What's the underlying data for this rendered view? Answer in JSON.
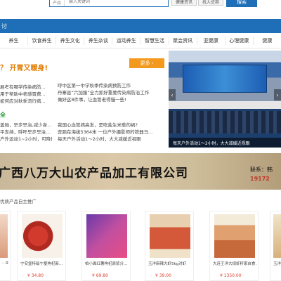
{
  "search": {
    "category": "产品",
    "placeholder": "输入关键词",
    "button": "搜索",
    "btn_a": "健康资讯",
    "btn_b": "找入驻商"
  },
  "band": {
    "label": "讨"
  },
  "nav": [
    "养生",
    "饮食养生",
    "养生文化",
    "养生杂谈",
    "运动养生",
    "智慧生活",
    "聚会资讯",
    "亚健康",
    "心理健康",
    "健康"
  ],
  "news": {
    "headline": "？ 开胃又暖身!",
    "more": "更多 ›",
    "left_lines": [
      "展考有哪学传染病防...",
      "用于帮助中老感冒费...",
      "如何应对秋季流行病..."
    ],
    "right_lines": [
      "呼中区第一中学秋季传染病预防工作",
      "丹寨县“六加服”全力抓好重要传染病防治工作",
      "做好这8件事，让血管老得慢一些!"
    ],
    "tag": "全",
    "left_lines2": [
      "盖驰，早步早治,减少身...",
      "平支持，呼吁早步早治...",
      "户外运动1~2小时，可降低近视几率"
    ],
    "right_lines2": [
      "我国心血管病高发，是吃盐生米惹的祸?",
      "奔跑在海拔5364米 一位户外摄影师的铁器马...",
      "每天户外活动1～2小时，大大减缓近视眼"
    ]
  },
  "slide": {
    "caption": "每天户外活动1～2小时，大大减缓近视眼",
    "prev": "‹",
    "next": "›"
  },
  "promo": {
    "title": "广西八万大山农产品加工有限公司",
    "contact": "联系：韩",
    "phone": "19172"
  },
  "section_title": "优质产品自主推广",
  "products": [
    {
      "name": "...g",
      "price": ""
    },
    {
      "name": "宁安堡特级宁夏枸杞新...",
      "price": "¥ 34.80"
    },
    {
      "name": "柏小鼻红薯枸杞原浆分...",
      "price": "¥ 69.80"
    },
    {
      "name": "玉洋麻辣大虾5kg对虾",
      "price": "¥ 39.00"
    },
    {
      "name": "大连王洋大规虾籽家自食...",
      "price": "¥ 1350.00"
    },
    {
      "name": "玉洋",
      "price": ""
    }
  ],
  "colors": {
    "brand_blue": "#1f6fb8",
    "accent_orange": "#f39a1e",
    "price_red": "#e03c2c"
  }
}
